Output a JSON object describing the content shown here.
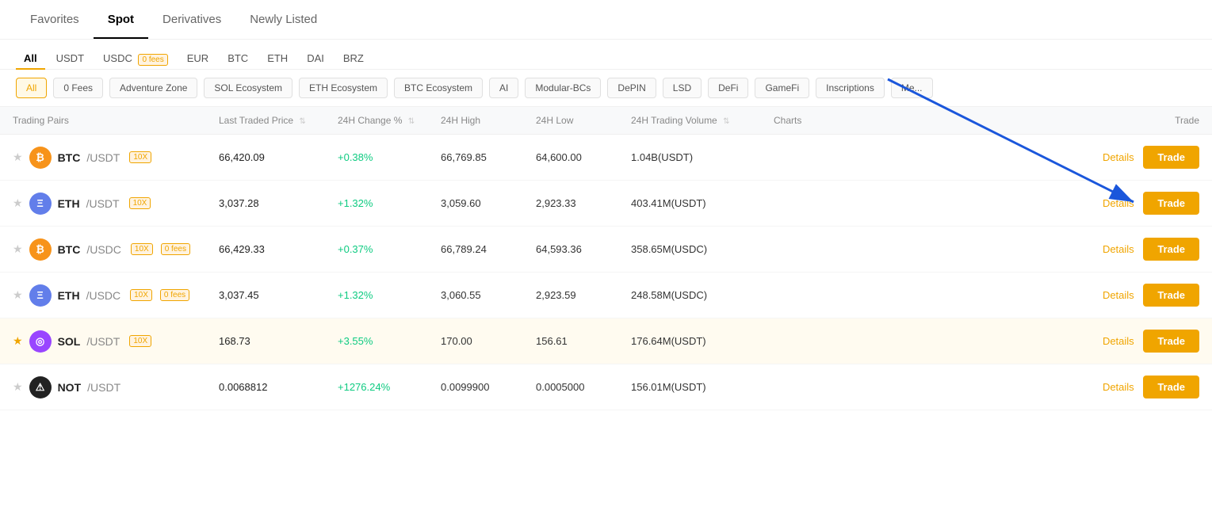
{
  "topTabs": [
    {
      "id": "favorites",
      "label": "Favorites",
      "active": false
    },
    {
      "id": "spot",
      "label": "Spot",
      "active": true
    },
    {
      "id": "derivatives",
      "label": "Derivatives",
      "active": false
    },
    {
      "id": "newly-listed",
      "label": "Newly Listed",
      "active": false
    }
  ],
  "currencyTabs": [
    {
      "id": "all",
      "label": "All",
      "active": true,
      "badge": null
    },
    {
      "id": "usdt",
      "label": "USDT",
      "active": false,
      "badge": null
    },
    {
      "id": "usdc",
      "label": "USDC",
      "active": false,
      "badge": "0 fees"
    },
    {
      "id": "eur",
      "label": "EUR",
      "active": false,
      "badge": null
    },
    {
      "id": "btc",
      "label": "BTC",
      "active": false,
      "badge": null
    },
    {
      "id": "eth",
      "label": "ETH",
      "active": false,
      "badge": null
    },
    {
      "id": "dai",
      "label": "DAI",
      "active": false,
      "badge": null
    },
    {
      "id": "brz",
      "label": "BRZ",
      "active": false,
      "badge": null
    }
  ],
  "filterTags": [
    {
      "id": "all",
      "label": "All",
      "active": true
    },
    {
      "id": "0fees",
      "label": "0 Fees",
      "active": false
    },
    {
      "id": "adventure-zone",
      "label": "Adventure Zone",
      "active": false
    },
    {
      "id": "sol-ecosystem",
      "label": "SOL Ecosystem",
      "active": false
    },
    {
      "id": "eth-ecosystem",
      "label": "ETH Ecosystem",
      "active": false
    },
    {
      "id": "btc-ecosystem",
      "label": "BTC Ecosystem",
      "active": false
    },
    {
      "id": "ai",
      "label": "AI",
      "active": false
    },
    {
      "id": "modular-bcs",
      "label": "Modular-BCs",
      "active": false
    },
    {
      "id": "depin",
      "label": "DePIN",
      "active": false
    },
    {
      "id": "lsd",
      "label": "LSD",
      "active": false
    },
    {
      "id": "defi",
      "label": "DeFi",
      "active": false
    },
    {
      "id": "gamefi",
      "label": "GameFi",
      "active": false
    },
    {
      "id": "inscriptions",
      "label": "Inscriptions",
      "active": false
    },
    {
      "id": "me",
      "label": "Me...",
      "active": false
    }
  ],
  "tableHeaders": {
    "tradingPairs": "Trading Pairs",
    "lastTradedPrice": "Last Traded Price",
    "change24h": "24H Change %",
    "high24h": "24H High",
    "low24h": "24H Low",
    "volume24h": "24H Trading Volume",
    "charts": "Charts",
    "trade": "Trade"
  },
  "rows": [
    {
      "id": "btc-usdt",
      "starred": false,
      "coinType": "btc",
      "base": "BTC",
      "quote": "/USDT",
      "leverage": "10X",
      "zeroFees": false,
      "lastPrice": "66,420.09",
      "change": "+0.38%",
      "changePositive": true,
      "high": "66,769.85",
      "low": "64,600.00",
      "volume": "1.04B(USDT)",
      "detailsLabel": "Details",
      "tradeLabel": "Trade"
    },
    {
      "id": "eth-usdt",
      "starred": false,
      "coinType": "eth",
      "base": "ETH",
      "quote": "/USDT",
      "leverage": "10X",
      "zeroFees": false,
      "lastPrice": "3,037.28",
      "change": "+1.32%",
      "changePositive": true,
      "high": "3,059.60",
      "low": "2,923.33",
      "volume": "403.41M(USDT)",
      "detailsLabel": "Details",
      "tradeLabel": "Trade"
    },
    {
      "id": "btc-usdc",
      "starred": false,
      "coinType": "btc",
      "base": "BTC",
      "quote": "/USDC",
      "leverage": "10X",
      "zeroFees": true,
      "lastPrice": "66,429.33",
      "change": "+0.37%",
      "changePositive": true,
      "high": "66,789.24",
      "low": "64,593.36",
      "volume": "358.65M(USDC)",
      "detailsLabel": "Details",
      "tradeLabel": "Trade"
    },
    {
      "id": "eth-usdc",
      "starred": false,
      "coinType": "eth",
      "base": "ETH",
      "quote": "/USDC",
      "leverage": "10X",
      "zeroFees": true,
      "lastPrice": "3,037.45",
      "change": "+1.32%",
      "changePositive": true,
      "high": "3,060.55",
      "low": "2,923.59",
      "volume": "248.58M(USDC)",
      "detailsLabel": "Details",
      "tradeLabel": "Trade"
    },
    {
      "id": "sol-usdt",
      "starred": true,
      "coinType": "sol",
      "base": "SOL",
      "quote": "/USDT",
      "leverage": "10X",
      "zeroFees": false,
      "lastPrice": "168.73",
      "change": "+3.55%",
      "changePositive": true,
      "high": "170.00",
      "low": "156.61",
      "volume": "176.64M(USDT)",
      "detailsLabel": "Details",
      "tradeLabel": "Trade"
    },
    {
      "id": "not-usdt",
      "starred": false,
      "coinType": "not",
      "base": "NOT",
      "quote": "/USDT",
      "leverage": null,
      "zeroFees": false,
      "lastPrice": "0.0068812",
      "change": "+1276.24%",
      "changePositive": true,
      "high": "0.0099900",
      "low": "0.0005000",
      "volume": "156.01M(USDT)",
      "detailsLabel": "Details",
      "tradeLabel": "Trade"
    }
  ],
  "arrowAnnotation": {
    "label": "Charts arrow annotation"
  }
}
